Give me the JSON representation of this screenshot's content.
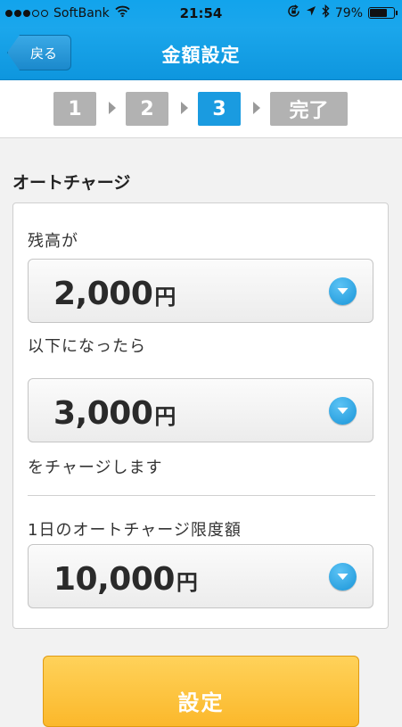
{
  "status_bar": {
    "carrier": "SoftBank",
    "signal_bars_filled": 3,
    "signal_bars_total": 5,
    "time": "21:54",
    "battery_percent": 79,
    "battery_label": "79%",
    "icons": [
      "wifi-icon",
      "orientation-lock-icon",
      "location-icon",
      "bluetooth-icon",
      "battery-icon"
    ]
  },
  "nav": {
    "back_label": "戻る",
    "title": "金額設定"
  },
  "steps": {
    "items": [
      "1",
      "2",
      "3",
      "完了"
    ],
    "active_index": 2
  },
  "auto_charge": {
    "section_title": "オートチャージ",
    "balance_label": "残高が",
    "threshold_amount": "2,000",
    "below_label": "以下になったら",
    "charge_amount": "3,000",
    "charge_label": "をチャージします",
    "daily_limit_label": "1日のオートチャージ限度額",
    "daily_limit_amount": "10,000",
    "unit": "円"
  },
  "confirm_label": "設定",
  "colors": {
    "nav_blue": "#1aa6ec",
    "step_active": "#1a9be0",
    "step_inactive": "#b2b2b2",
    "confirm_yellow": "#fbb82b"
  }
}
